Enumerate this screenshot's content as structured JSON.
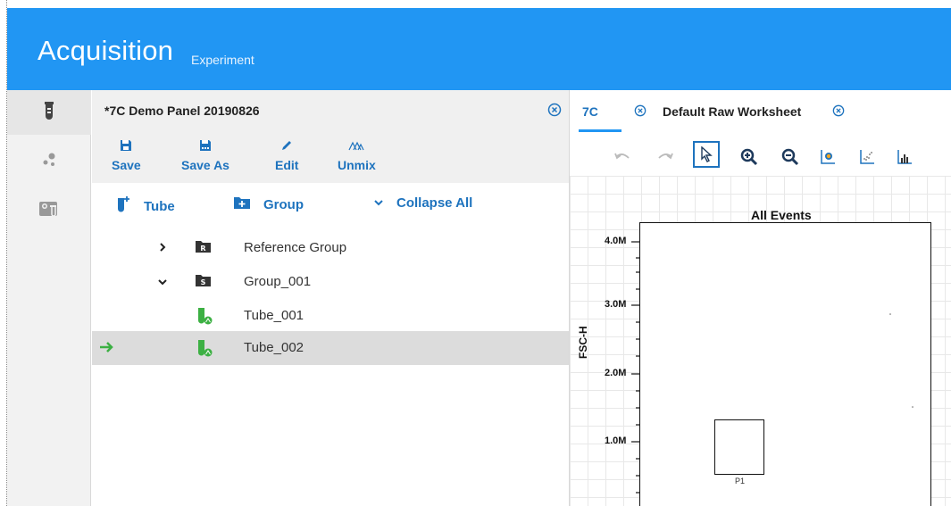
{
  "app": {
    "title": "Acquisition",
    "subtitle": "Experiment"
  },
  "rail": {
    "items": [
      {
        "icon": "test-tube-icon",
        "active": true
      },
      {
        "icon": "cells-icon",
        "active": false
      },
      {
        "icon": "instrument-icon",
        "active": false
      }
    ]
  },
  "panel": {
    "title": "*7C Demo Panel 20190826",
    "toolbar": {
      "save": "Save",
      "save_as": "Save As",
      "edit": "Edit",
      "unmix": "Unmix"
    },
    "actions": {
      "tube": "Tube",
      "group": "Group",
      "collapse_all": "Collapse All"
    },
    "tree": [
      {
        "label": "Reference Group",
        "badge": "R",
        "type": "group",
        "expanded": false
      },
      {
        "label": "Group_001",
        "badge": "S",
        "type": "group",
        "expanded": true
      },
      {
        "label": "Tube_001",
        "type": "tube"
      },
      {
        "label": "Tube_002",
        "type": "tube",
        "selected": true
      }
    ]
  },
  "worksheet": {
    "tabs": {
      "tab1": "7C",
      "tab2": "Default Raw Worksheet"
    },
    "plot": {
      "title": "All Events",
      "ylabel": "FSC-H",
      "yticks": [
        "4.0M",
        "3.0M",
        "2.0M",
        "1.0M"
      ],
      "gate_label": "P1"
    }
  },
  "colors": {
    "header": "#2196f3",
    "accent": "#1e73be",
    "tube_green": "#3cb043",
    "arrow_green": "#3cb043"
  }
}
